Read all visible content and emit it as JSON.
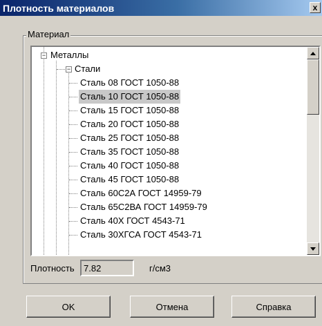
{
  "window": {
    "title": "Плотность материалов",
    "close_glyph": "x"
  },
  "group": {
    "label": "Материал"
  },
  "tree": {
    "root": {
      "label": "Металлы",
      "expander": "−"
    },
    "child": {
      "label": "Стали",
      "expander": "−"
    },
    "items": [
      "Сталь 08 ГОСТ 1050-88",
      "Сталь 10 ГОСТ 1050-88",
      "Сталь 15 ГОСТ 1050-88",
      "Сталь 20 ГОСТ 1050-88",
      "Сталь 25 ГОСТ 1050-88",
      "Сталь 35 ГОСТ 1050-88",
      "Сталь 40 ГОСТ 1050-88",
      "Сталь 45 ГОСТ 1050-88",
      "Сталь 60С2А ГОСТ 14959-79",
      "Сталь 65С2ВА ГОСТ 14959-79",
      "Сталь 40Х ГОСТ 4543-71",
      "Сталь 30ХГСА ГОСТ 4543-71"
    ],
    "selected_index": 1
  },
  "density": {
    "label": "Плотность",
    "value": "7.82",
    "unit": "г/см3"
  },
  "buttons": {
    "ok": "OK",
    "cancel": "Отмена",
    "help": "Справка"
  },
  "colors": {
    "titlebar_start": "#0a246a",
    "titlebar_end": "#a6caf0",
    "selection": "#c8c8c8"
  }
}
